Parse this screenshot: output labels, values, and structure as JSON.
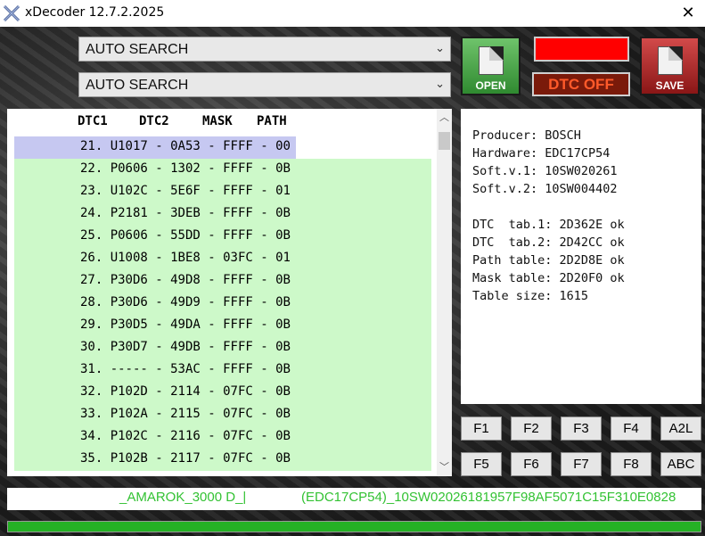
{
  "window": {
    "title": "xDecoder 12.7.2.2025",
    "close_glyph": "✕"
  },
  "combos": [
    {
      "value": "AUTO SEARCH"
    },
    {
      "value": "AUTO SEARCH"
    }
  ],
  "buttons": {
    "open": "OPEN",
    "save": "SAVE",
    "dtc_off": "DTC OFF"
  },
  "colors": {
    "indicator": "#ff0000",
    "row_green": "#cdf9c9",
    "row_selected": "#c6c8f1",
    "status_text": "#33c233",
    "progress": "#25b125"
  },
  "table": {
    "headers": [
      "DTC1",
      "DTC2",
      "MASK",
      "PATH"
    ],
    "rows": [
      "21. U1017 - 0A53 - FFFF - 00",
      "22. P0606 - 1302 - FFFF - 0B",
      "23. U102C - 5E6F - FFFF - 01",
      "24. P2181 - 3DEB - FFFF - 0B",
      "25. P0606 - 55DD - FFFF - 0B",
      "26. U1008 - 1BE8 - 03FC - 01",
      "27. P30D6 - 49D8 - FFFF - 0B",
      "28. P30D6 - 49D9 - FFFF - 0B",
      "29. P30D5 - 49DA - FFFF - 0B",
      "30. P30D7 - 49DB - FFFF - 0B",
      "31. ----- - 53AC - FFFF - 0B",
      "32. P102D - 2114 - 07FC - 0B",
      "33. P102A - 2115 - 07FC - 0B",
      "34. P102C - 2116 - 07FC - 0B",
      "35. P102B - 2117 - 07FC - 0B"
    ],
    "selected_index": 0
  },
  "info": {
    "lines": [
      "Producer: BOSCH",
      "Hardware: EDC17CP54",
      "Soft.v.1: 10SW020261",
      "Soft.v.2: 10SW004402",
      "",
      "DTC  tab.1: 2D362E ok",
      "DTC  tab.2: 2D42CC ok",
      "Path table: 2D2D8E ok",
      "Mask table: 2D20F0 ok",
      "Table size: 1615"
    ]
  },
  "fkeys": {
    "row1": [
      "F1",
      "F2",
      "F3",
      "F4",
      "A2L"
    ],
    "row2": [
      "F5",
      "F6",
      "F7",
      "F8",
      "ABC"
    ]
  },
  "status": {
    "left": "_AMAROK_3000 D_|",
    "right": "(EDC17CP54)_10SW02026181957F98AF5071C15F310E0828"
  },
  "progress": {
    "percent": 100
  }
}
